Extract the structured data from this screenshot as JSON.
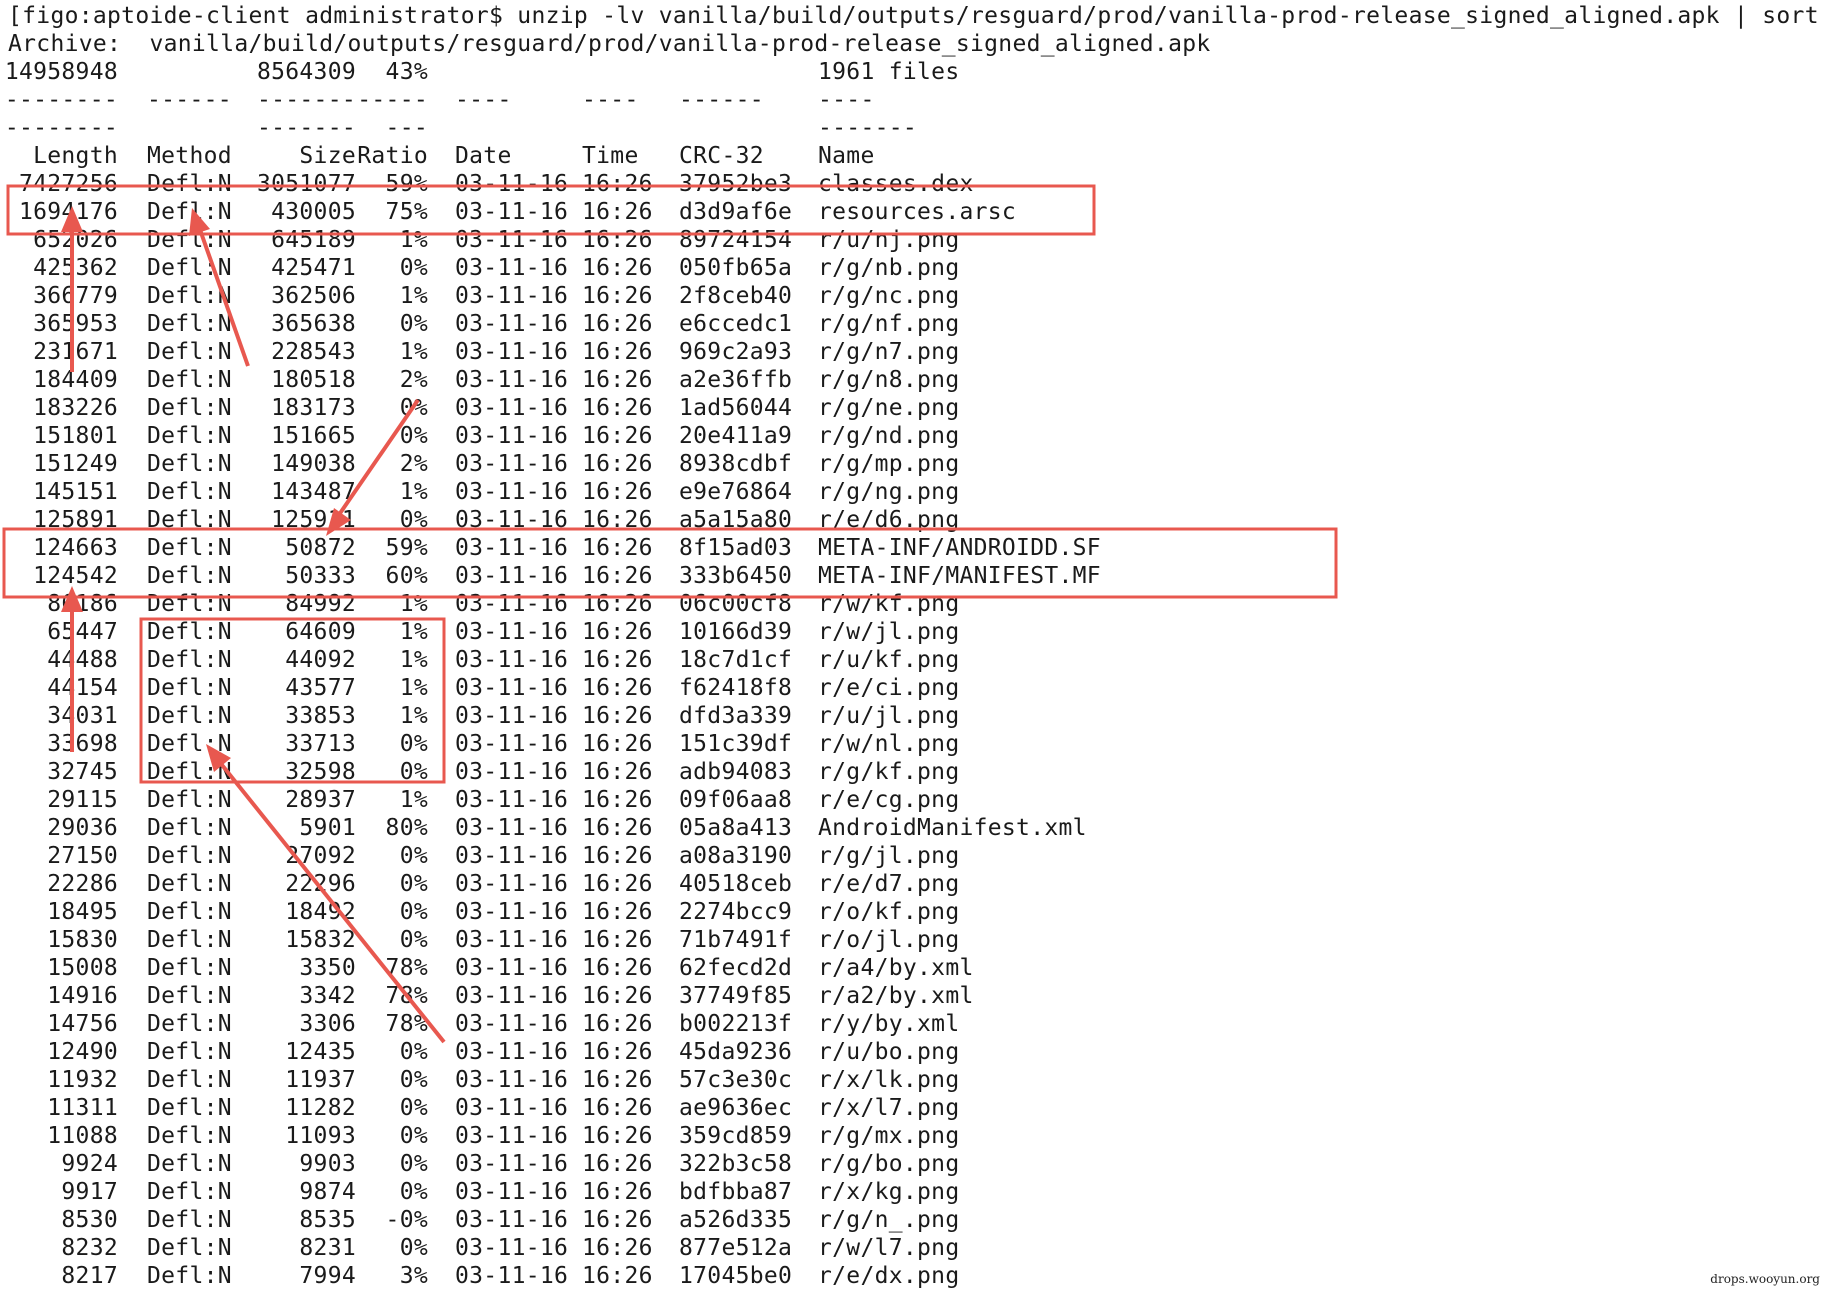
{
  "prompt_line": "[figo:aptoide-client administrator$ unzip -lv vanilla/build/outputs/resguard/prod/vanilla-prod-release_signed_aligned.apk | sort -r",
  "archive_line": "Archive:  vanilla/build/outputs/resguard/prod/vanilla-prod-release_signed_aligned.apk",
  "summary": {
    "length": "14958948",
    "size": "8564309",
    "ratio": "43%",
    "files": "1961 files"
  },
  "dash_row_1": [
    "--------",
    "------",
    "-------",
    "-----",
    "----",
    "----",
    "------",
    "----"
  ],
  "dash_row_2": [
    "--------",
    "",
    "-------",
    "---",
    "",
    "",
    "",
    "-------"
  ],
  "headers": [
    "Length",
    "Method",
    "Size",
    "Ratio",
    "Date",
    "Time",
    "CRC-32",
    "Name"
  ],
  "rows": [
    [
      "7427256",
      "Defl:N",
      "3051077",
      "59%",
      "03-11-16",
      "16:26",
      "37952be3",
      "classes.dex"
    ],
    [
      "1694176",
      "Defl:N",
      "430005",
      "75%",
      "03-11-16",
      "16:26",
      "d3d9af6e",
      "resources.arsc"
    ],
    [
      "652026",
      "Defl:N",
      "645189",
      "1%",
      "03-11-16",
      "16:26",
      "89724154",
      "r/u/nj.png"
    ],
    [
      "425362",
      "Defl:N",
      "425471",
      "0%",
      "03-11-16",
      "16:26",
      "050fb65a",
      "r/g/nb.png"
    ],
    [
      "366779",
      "Defl:N",
      "362506",
      "1%",
      "03-11-16",
      "16:26",
      "2f8ceb40",
      "r/g/nc.png"
    ],
    [
      "365953",
      "Defl:N",
      "365638",
      "0%",
      "03-11-16",
      "16:26",
      "e6ccedc1",
      "r/g/nf.png"
    ],
    [
      "231671",
      "Defl:N",
      "228543",
      "1%",
      "03-11-16",
      "16:26",
      "969c2a93",
      "r/g/n7.png"
    ],
    [
      "184409",
      "Defl:N",
      "180518",
      "2%",
      "03-11-16",
      "16:26",
      "a2e36ffb",
      "r/g/n8.png"
    ],
    [
      "183226",
      "Defl:N",
      "183173",
      "0%",
      "03-11-16",
      "16:26",
      "1ad56044",
      "r/g/ne.png"
    ],
    [
      "151801",
      "Defl:N",
      "151665",
      "0%",
      "03-11-16",
      "16:26",
      "20e411a9",
      "r/g/nd.png"
    ],
    [
      "151249",
      "Defl:N",
      "149038",
      "2%",
      "03-11-16",
      "16:26",
      "8938cdbf",
      "r/g/mp.png"
    ],
    [
      "145151",
      "Defl:N",
      "143487",
      "1%",
      "03-11-16",
      "16:26",
      "e9e76864",
      "r/g/ng.png"
    ],
    [
      "125891",
      "Defl:N",
      "125911",
      "0%",
      "03-11-16",
      "16:26",
      "a5a15a80",
      "r/e/d6.png"
    ],
    [
      "124663",
      "Defl:N",
      "50872",
      "59%",
      "03-11-16",
      "16:26",
      "8f15ad03",
      "META-INF/ANDROIDD.SF"
    ],
    [
      "124542",
      "Defl:N",
      "50333",
      "60%",
      "03-11-16",
      "16:26",
      "333b6450",
      "META-INF/MANIFEST.MF"
    ],
    [
      "86186",
      "Defl:N",
      "84992",
      "1%",
      "03-11-16",
      "16:26",
      "06c00cf8",
      "r/w/kf.png"
    ],
    [
      "65447",
      "Defl:N",
      "64609",
      "1%",
      "03-11-16",
      "16:26",
      "10166d39",
      "r/w/jl.png"
    ],
    [
      "44488",
      "Defl:N",
      "44092",
      "1%",
      "03-11-16",
      "16:26",
      "18c7d1cf",
      "r/u/kf.png"
    ],
    [
      "44154",
      "Defl:N",
      "43577",
      "1%",
      "03-11-16",
      "16:26",
      "f62418f8",
      "r/e/ci.png"
    ],
    [
      "34031",
      "Defl:N",
      "33853",
      "1%",
      "03-11-16",
      "16:26",
      "dfd3a339",
      "r/u/jl.png"
    ],
    [
      "33698",
      "Defl:N",
      "33713",
      "0%",
      "03-11-16",
      "16:26",
      "151c39df",
      "r/w/nl.png"
    ],
    [
      "32745",
      "Defl:N",
      "32598",
      "0%",
      "03-11-16",
      "16:26",
      "adb94083",
      "r/g/kf.png"
    ],
    [
      "29115",
      "Defl:N",
      "28937",
      "1%",
      "03-11-16",
      "16:26",
      "09f06aa8",
      "r/e/cg.png"
    ],
    [
      "29036",
      "Defl:N",
      "5901",
      "80%",
      "03-11-16",
      "16:26",
      "05a8a413",
      "AndroidManifest.xml"
    ],
    [
      "27150",
      "Defl:N",
      "27092",
      "0%",
      "03-11-16",
      "16:26",
      "a08a3190",
      "r/g/jl.png"
    ],
    [
      "22286",
      "Defl:N",
      "22296",
      "0%",
      "03-11-16",
      "16:26",
      "40518ceb",
      "r/e/d7.png"
    ],
    [
      "18495",
      "Defl:N",
      "18492",
      "0%",
      "03-11-16",
      "16:26",
      "2274bcc9",
      "r/o/kf.png"
    ],
    [
      "15830",
      "Defl:N",
      "15832",
      "0%",
      "03-11-16",
      "16:26",
      "71b7491f",
      "r/o/jl.png"
    ],
    [
      "15008",
      "Defl:N",
      "3350",
      "78%",
      "03-11-16",
      "16:26",
      "62fecd2d",
      "r/a4/by.xml"
    ],
    [
      "14916",
      "Defl:N",
      "3342",
      "78%",
      "03-11-16",
      "16:26",
      "37749f85",
      "r/a2/by.xml"
    ],
    [
      "14756",
      "Defl:N",
      "3306",
      "78%",
      "03-11-16",
      "16:26",
      "b002213f",
      "r/y/by.xml"
    ],
    [
      "12490",
      "Defl:N",
      "12435",
      "0%",
      "03-11-16",
      "16:26",
      "45da9236",
      "r/u/bo.png"
    ],
    [
      "11932",
      "Defl:N",
      "11937",
      "0%",
      "03-11-16",
      "16:26",
      "57c3e30c",
      "r/x/lk.png"
    ],
    [
      "11311",
      "Defl:N",
      "11282",
      "0%",
      "03-11-16",
      "16:26",
      "ae9636ec",
      "r/x/l7.png"
    ],
    [
      "11088",
      "Defl:N",
      "11093",
      "0%",
      "03-11-16",
      "16:26",
      "359cd859",
      "r/g/mx.png"
    ],
    [
      "9924",
      "Defl:N",
      "9903",
      "0%",
      "03-11-16",
      "16:26",
      "322b3c58",
      "r/g/bo.png"
    ],
    [
      "9917",
      "Defl:N",
      "9874",
      "0%",
      "03-11-16",
      "16:26",
      "bdfbba87",
      "r/x/kg.png"
    ],
    [
      "8530",
      "Defl:N",
      "8535",
      "-0%",
      "03-11-16",
      "16:26",
      "a526d335",
      "r/g/n_.png"
    ],
    [
      "8232",
      "Defl:N",
      "8231",
      "0%",
      "03-11-16",
      "16:26",
      "877e512a",
      "r/w/l7.png"
    ],
    [
      "8217",
      "Defl:N",
      "7994",
      "3%",
      "03-11-16",
      "16:26",
      "17045be0",
      "r/e/dx.png"
    ]
  ],
  "watermark": "drops.wooyun.org",
  "colors": {
    "annotation": "#e8584f",
    "text": "#1a1a1a",
    "background": "#ffffff"
  }
}
